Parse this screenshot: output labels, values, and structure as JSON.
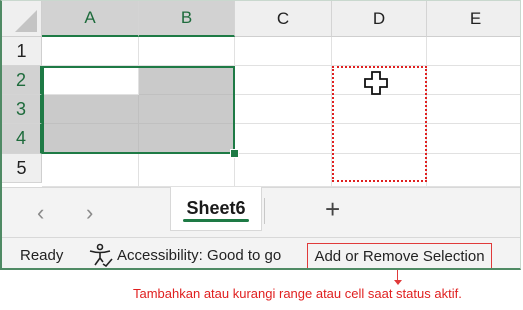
{
  "columns": [
    "A",
    "B",
    "C",
    "D",
    "E"
  ],
  "rows": [
    "1",
    "2",
    "3",
    "4",
    "5"
  ],
  "selected_columns": [
    "A",
    "B"
  ],
  "selected_rows": [
    "2",
    "3",
    "4"
  ],
  "sheet_tabs": {
    "active": "Sheet6",
    "prev_arrow": "‹",
    "next_arrow": "›",
    "add_button": "+"
  },
  "status_bar": {
    "ready": "Ready",
    "accessibility": "Accessibility: Good to go",
    "mode": "Add or Remove Selection"
  },
  "annotation": {
    "text": "Tambahkan atau kurangi range atau cell saat status aktif."
  },
  "colors": {
    "accent": "#1e7a45",
    "highlight": "#e02020",
    "selection_fill": "#cacaca"
  },
  "icons": {
    "cursor": "cross-cursor-icon",
    "accessibility": "accessibility-icon"
  }
}
